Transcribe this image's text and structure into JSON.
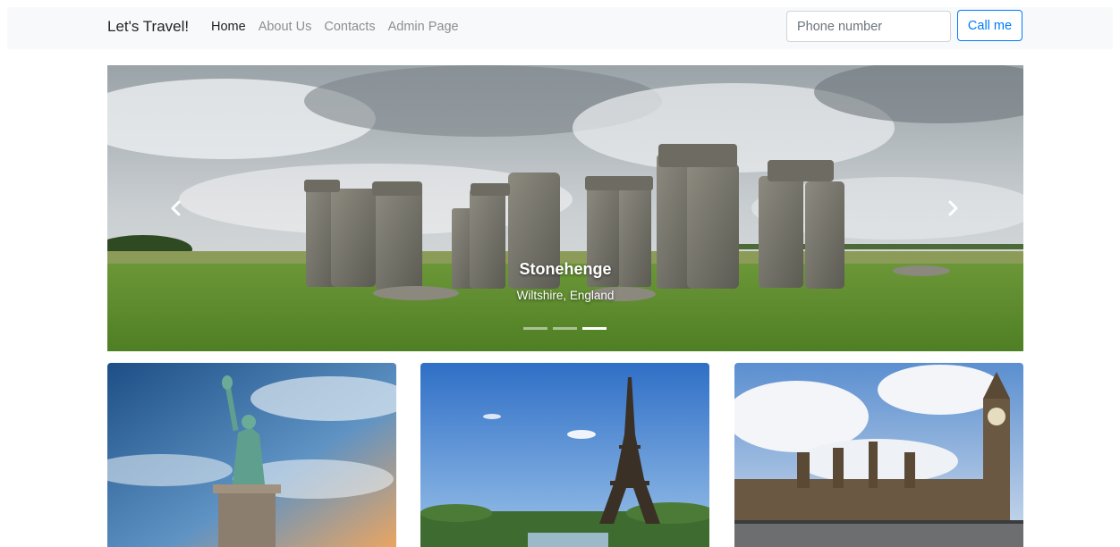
{
  "navbar": {
    "brand": "Let's Travel!",
    "links": [
      {
        "label": "Home",
        "active": true
      },
      {
        "label": "About Us",
        "active": false
      },
      {
        "label": "Contacts",
        "active": false
      },
      {
        "label": "Admin Page",
        "active": false
      }
    ],
    "phone_placeholder": "Phone number",
    "phone_value": "",
    "call_label": "Call me"
  },
  "carousel": {
    "title": "Stonehenge",
    "subtitle": "Wiltshire, England",
    "slide_count": 3,
    "active_index": 2,
    "prev_icon": "chevron-left-icon",
    "next_icon": "chevron-right-icon"
  },
  "cards": [
    {
      "image": "statue-of-liberty-photo"
    },
    {
      "image": "eiffel-tower-photo"
    },
    {
      "image": "big-ben-westminster-photo"
    }
  ],
  "colors": {
    "navbar_bg": "#f8f9fa",
    "primary": "#007bff",
    "nav_muted": "#8a8f94"
  }
}
